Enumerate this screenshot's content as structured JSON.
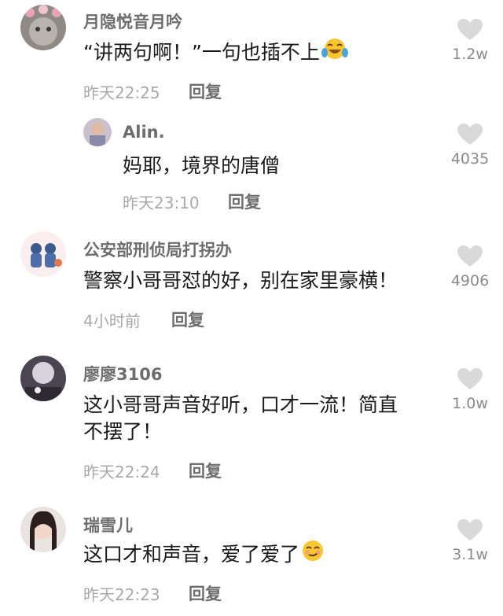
{
  "comments": [
    {
      "user": "月隐悦音月吟",
      "text": "“讲两句啊！”一句也插不上",
      "time": "昨天22:25",
      "reply": "回复",
      "likes": "1.2w",
      "emoji": "laughing-tears-emoji"
    },
    {
      "user": "Alin.",
      "text": "妈耶，境界的唐僧",
      "time": "昨天23:10",
      "reply": "回复",
      "likes": "4035"
    },
    {
      "user": "公安部刑侦局打拐办",
      "text": "警察小哥哥怼的好，别在家里豪横！",
      "time": "4小时前",
      "reply": "回复",
      "likes": "4906"
    },
    {
      "user": "廖廖3106",
      "text_line1": "这小哥哥声音好听，口才一流！简直",
      "text_line2": "不摆了！",
      "time": "昨天22:24",
      "reply": "回复",
      "likes": "1.0w"
    },
    {
      "user": "瑞雪儿",
      "text": "这口才和声音，爱了爱了",
      "time": "昨天22:23",
      "reply": "回复",
      "likes": "3.1w",
      "emoji": "smirk-emoji"
    }
  ],
  "colors": {
    "heart": "#d9d9d9",
    "username": "#6d6d6d",
    "time": "#a9a9a9"
  }
}
